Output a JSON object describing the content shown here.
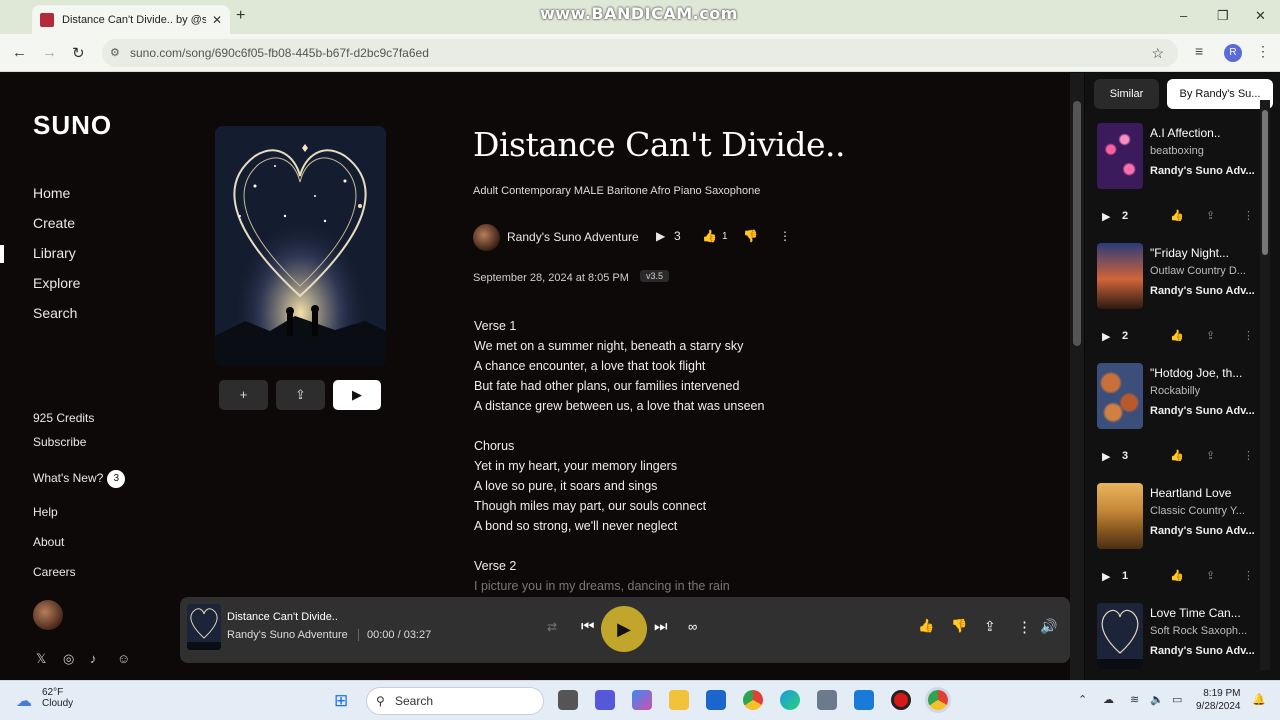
{
  "browser": {
    "tab_title": "Distance Can't Divide.. by @son",
    "close": "✕",
    "new_tab": "+",
    "watermark": "www.BANDICAM.com",
    "url": "suno.com/song/690c6f05-fb08-445b-b67f-d2bc9c7fa6ed",
    "profile_initial": "R",
    "win_min": "–",
    "win_max": "❐",
    "win_close": "✕"
  },
  "sidebar": {
    "logo": "SUNO",
    "nav": [
      {
        "label": "Home"
      },
      {
        "label": "Create"
      },
      {
        "label": "Library"
      },
      {
        "label": "Explore"
      },
      {
        "label": "Search"
      }
    ],
    "credits": "925 Credits",
    "subscribe": "Subscribe",
    "whats_new": "What's New?",
    "whats_new_count": "3",
    "help": "Help",
    "about": "About",
    "careers": "Careers"
  },
  "song": {
    "title": "Distance Can't Divide..",
    "tags": "Adult Contemporary MALE Baritone Afro Piano Saxophone",
    "artist": "Randy's Suno Adventure",
    "plays": "3",
    "likes": "1",
    "date": "September 28, 2024 at 8:05 PM",
    "version": "v3.5",
    "buttons": {
      "add": "+",
      "share": "⇪",
      "play": "▶"
    },
    "lyrics": [
      "Verse 1",
      "We met on a summer night, beneath a starry sky",
      "A chance encounter, a love that took flight",
      "But fate had other plans, our families intervened",
      "A distance grew between us, a love that was unseen",
      "",
      "Chorus",
      "Yet in my heart, your memory lingers",
      "A love so pure, it soars and sings",
      "Though miles may part, our souls connect",
      "A bond so strong, we'll never neglect",
      "",
      "Verse 2",
      "I picture you in my dreams, dancing in the rain"
    ]
  },
  "player": {
    "title": "Distance Can't Divide..",
    "artist": "Randy's Suno Adventure",
    "time": "00:00 / 03:27"
  },
  "right_panel": {
    "tabs": [
      {
        "label": "Similar"
      },
      {
        "label": "By Randy's Su..."
      }
    ],
    "cards": [
      {
        "title": "A.I Affection..",
        "genre": "beatboxing",
        "artist": "Randy's Suno Adv...",
        "plays": "2"
      },
      {
        "title": "\"Friday Night...",
        "genre": "Outlaw Country D...",
        "artist": "Randy's Suno Adv...",
        "plays": "2"
      },
      {
        "title": "\"Hotdog Joe, th...",
        "genre": "Rockabilly",
        "artist": "Randy's Suno Adv...",
        "plays": "3"
      },
      {
        "title": "Heartland Love",
        "genre": "Classic Country Y...",
        "artist": "Randy's Suno Adv...",
        "plays": "1"
      },
      {
        "title": "Love Time Can...",
        "genre": "Soft Rock Saxoph...",
        "artist": "Randy's Suno Adv...",
        "plays": ""
      }
    ]
  },
  "taskbar": {
    "temp": "62°F",
    "weather": "Cloudy",
    "search": "Search",
    "time": "8:19 PM",
    "date": "9/28/2024"
  }
}
